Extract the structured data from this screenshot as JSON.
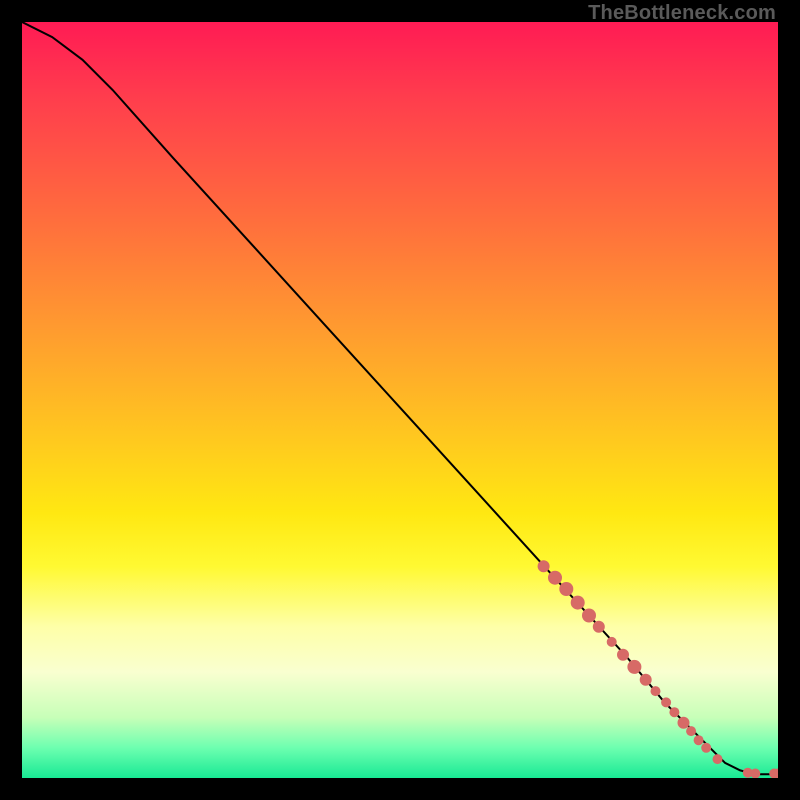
{
  "watermark": "TheBottleneck.com",
  "chart_data": {
    "type": "line",
    "title": "",
    "xlabel": "",
    "ylabel": "",
    "xlim": [
      0,
      100
    ],
    "ylim": [
      0,
      100
    ],
    "grid": false,
    "series": [
      {
        "name": "curve",
        "x": [
          0,
          4,
          8,
          12,
          20,
          30,
          40,
          50,
          60,
          70,
          80,
          85,
          90,
          93,
          95,
          97,
          100
        ],
        "y": [
          100,
          98,
          95,
          91,
          82,
          71,
          60,
          49,
          38,
          27,
          16,
          10,
          5,
          2,
          1,
          0.5,
          0.5
        ]
      }
    ],
    "markers": [
      {
        "x": 69.0,
        "y": 28.0,
        "r": 6
      },
      {
        "x": 70.5,
        "y": 26.5,
        "r": 7
      },
      {
        "x": 72.0,
        "y": 25.0,
        "r": 7
      },
      {
        "x": 73.5,
        "y": 23.2,
        "r": 7
      },
      {
        "x": 75.0,
        "y": 21.5,
        "r": 7
      },
      {
        "x": 76.3,
        "y": 20.0,
        "r": 6
      },
      {
        "x": 78.0,
        "y": 18.0,
        "r": 5
      },
      {
        "x": 79.5,
        "y": 16.3,
        "r": 6
      },
      {
        "x": 81.0,
        "y": 14.7,
        "r": 7
      },
      {
        "x": 82.5,
        "y": 13.0,
        "r": 6
      },
      {
        "x": 83.8,
        "y": 11.5,
        "r": 5
      },
      {
        "x": 85.2,
        "y": 10.0,
        "r": 5
      },
      {
        "x": 86.3,
        "y": 8.7,
        "r": 5
      },
      {
        "x": 87.5,
        "y": 7.3,
        "r": 6
      },
      {
        "x": 88.5,
        "y": 6.2,
        "r": 5
      },
      {
        "x": 89.5,
        "y": 5.0,
        "r": 5
      },
      {
        "x": 90.5,
        "y": 4.0,
        "r": 5
      },
      {
        "x": 92.0,
        "y": 2.5,
        "r": 5
      },
      {
        "x": 96.0,
        "y": 0.7,
        "r": 5
      },
      {
        "x": 97.0,
        "y": 0.6,
        "r": 5
      },
      {
        "x": 99.5,
        "y": 0.6,
        "r": 5
      },
      {
        "x": 100.0,
        "y": 0.6,
        "r": 5
      }
    ],
    "colors": {
      "curve": "#000000",
      "marker": "#d76a66",
      "marker_stroke": "#d76a66"
    }
  }
}
